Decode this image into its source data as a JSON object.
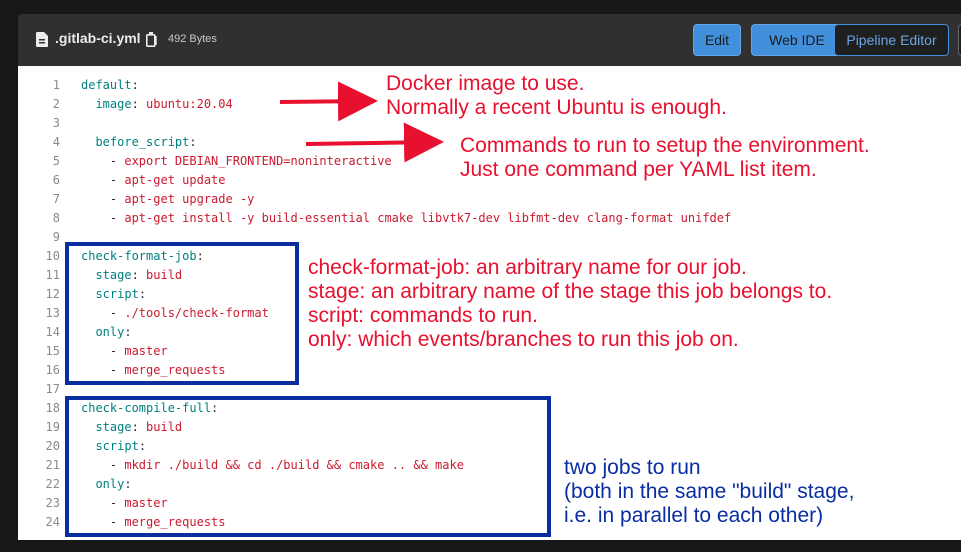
{
  "file": {
    "name": ".gitlab-ci.yml",
    "size": "492 Bytes",
    "icon": "file-icon",
    "copy_icon": "copy-icon"
  },
  "toolbar": {
    "edit_label": "Edit",
    "web_ide_label": "Web IDE",
    "pipeline_editor_label": "Pipeline Editor"
  },
  "code": {
    "lines": [
      {
        "n": "1",
        "key": "default",
        "sep": ":",
        "val": ""
      },
      {
        "n": "2",
        "indent": "  ",
        "key": "image",
        "sep": ": ",
        "val": "ubuntu:20.04"
      },
      {
        "n": "3",
        "key": "",
        "sep": "",
        "val": ""
      },
      {
        "n": "4",
        "indent": "  ",
        "key": "before_script",
        "sep": ":",
        "val": ""
      },
      {
        "n": "5",
        "indent": "    ",
        "dash": "- ",
        "val": "export DEBIAN_FRONTEND=noninteractive"
      },
      {
        "n": "6",
        "indent": "    ",
        "dash": "- ",
        "val": "apt-get update"
      },
      {
        "n": "7",
        "indent": "    ",
        "dash": "- ",
        "val": "apt-get upgrade -y"
      },
      {
        "n": "8",
        "indent": "    ",
        "dash": "- ",
        "val": "apt-get install -y build-essential cmake libvtk7-dev libfmt-dev clang-format unifdef"
      },
      {
        "n": "9",
        "key": "",
        "sep": "",
        "val": ""
      },
      {
        "n": "10",
        "key": "check-format-job",
        "sep": ":",
        "val": ""
      },
      {
        "n": "11",
        "indent": "  ",
        "key": "stage",
        "sep": ": ",
        "val": "build"
      },
      {
        "n": "12",
        "indent": "  ",
        "key": "script",
        "sep": ":",
        "val": ""
      },
      {
        "n": "13",
        "indent": "    ",
        "dash": "- ",
        "val": "./tools/check-format"
      },
      {
        "n": "14",
        "indent": "  ",
        "key": "only",
        "sep": ":",
        "val": ""
      },
      {
        "n": "15",
        "indent": "    ",
        "dash": "- ",
        "val": "master"
      },
      {
        "n": "16",
        "indent": "    ",
        "dash": "- ",
        "val": "merge_requests"
      },
      {
        "n": "17",
        "key": "",
        "sep": "",
        "val": ""
      },
      {
        "n": "18",
        "key": "check-compile-full",
        "sep": ":",
        "val": ""
      },
      {
        "n": "19",
        "indent": "  ",
        "key": "stage",
        "sep": ": ",
        "val": "build"
      },
      {
        "n": "20",
        "indent": "  ",
        "key": "script",
        "sep": ":",
        "val": ""
      },
      {
        "n": "21",
        "indent": "    ",
        "dash": "- ",
        "val": "mkdir ./build && cd ./build && cmake .. && make"
      },
      {
        "n": "22",
        "indent": "  ",
        "key": "only",
        "sep": ":",
        "val": ""
      },
      {
        "n": "23",
        "indent": "    ",
        "dash": "- ",
        "val": "master"
      },
      {
        "n": "24",
        "indent": "    ",
        "dash": "- ",
        "val": "merge_requests"
      }
    ]
  },
  "annotations": {
    "image": [
      "Docker image to use.",
      "Normally a recent Ubuntu is enough."
    ],
    "before_script": [
      "Commands to run to setup the environment.",
      "Just one command per YAML list item."
    ],
    "job": [
      "check-format-job: an arbitrary name for our job.",
      "stage: an arbitrary name of the stage this job belongs to.",
      "script: commands to run.",
      "only: which events/branches to run this job on."
    ],
    "two_jobs": [
      "two jobs to run",
      "(both in the same \"build\" stage,",
      "i.e. in parallel to each other)"
    ]
  },
  "colors": {
    "annotation_red": "#e8102f",
    "annotation_blue": "#0a2d9f",
    "yaml_key": "#008080",
    "yaml_value": "#cc1a2f",
    "button_blue": "#428fdc"
  }
}
